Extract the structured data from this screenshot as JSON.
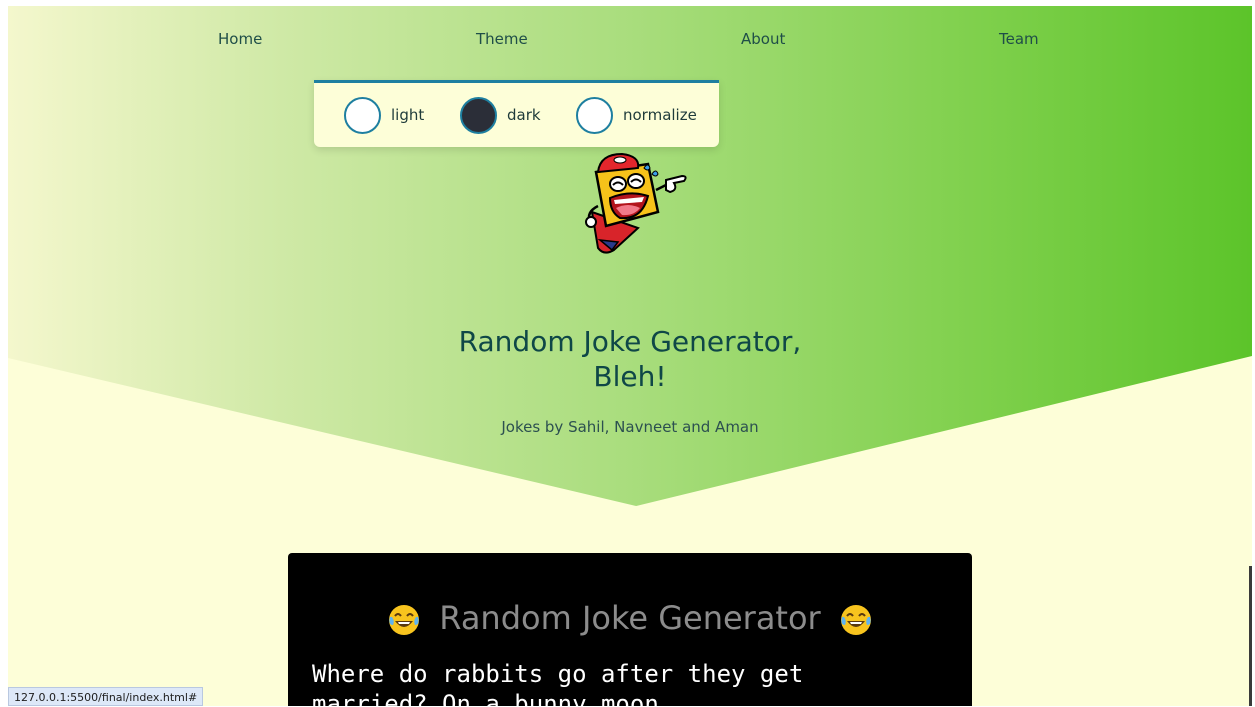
{
  "nav": {
    "items": [
      {
        "label": "Home"
      },
      {
        "label": "Theme"
      },
      {
        "label": "About"
      },
      {
        "label": "Team"
      }
    ]
  },
  "theme_menu": {
    "options": [
      {
        "label": "light",
        "swatch_color": "#ffffff"
      },
      {
        "label": "dark",
        "swatch_color": "#2b2e38"
      },
      {
        "label": "normalize",
        "swatch_color": "#ffffff"
      }
    ],
    "accent_color": "#1e7fa0"
  },
  "hero": {
    "title_line1": "Random Joke Generator,",
    "title_line2": "Bleh!",
    "subtitle": "Jokes by Sahil, Navneet and Aman",
    "mascot_icon": "laughing-mascot-icon"
  },
  "joke_card": {
    "heading": "Random Joke Generator",
    "heading_emoji_icon": "laughing-tears-emoji-icon",
    "joke_line1": "Where do rabbits go after they get",
    "joke_line2": "married? On a bunny moon."
  },
  "status_bar": {
    "url": "127.0.0.1:5500/final/index.html#"
  },
  "colors": {
    "gradient_left": "#f4f7cd",
    "gradient_right": "#5cc42a",
    "page_bg": "#fdfed8",
    "card_bg": "#000000",
    "title_color": "#0f4747"
  }
}
